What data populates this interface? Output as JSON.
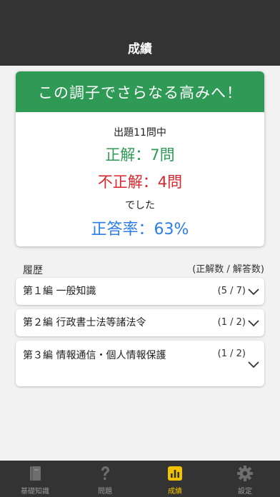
{
  "header": {
    "title": "成績"
  },
  "result": {
    "banner": "この調子でさらなる高みへ！",
    "total_text": "出題11問中",
    "correct_text": "正解：7問",
    "incorrect_text": "不正解：4問",
    "deshita_text": "でした",
    "rate_text": "正答率：63%"
  },
  "history": {
    "title": "履歴",
    "legend": "(正解数 / 解答数)",
    "items": [
      {
        "label": "第１編 一般知識",
        "score": "(5 / 7)"
      },
      {
        "label": "第２編 行政書士法等諸法令",
        "score": "(1 / 2)"
      },
      {
        "label": "第３編 情報通信・個人情報保護",
        "score": "(1 / 2)"
      }
    ]
  },
  "tabs": [
    {
      "label": "基礎知識",
      "icon": "book-icon",
      "active": false
    },
    {
      "label": "問題",
      "icon": "question-icon",
      "active": false
    },
    {
      "label": "成績",
      "icon": "bar-chart-icon",
      "active": true
    },
    {
      "label": "設定",
      "icon": "gear-icon",
      "active": false
    }
  ],
  "colors": {
    "header_bg": "#333333",
    "banner_green": "#2f9a55",
    "correct_green": "#2f9a55",
    "incorrect_red": "#d9262c",
    "rate_blue": "#2b7de9",
    "active_tab": "#f2c100",
    "inactive_tab": "#9a9a9a"
  }
}
